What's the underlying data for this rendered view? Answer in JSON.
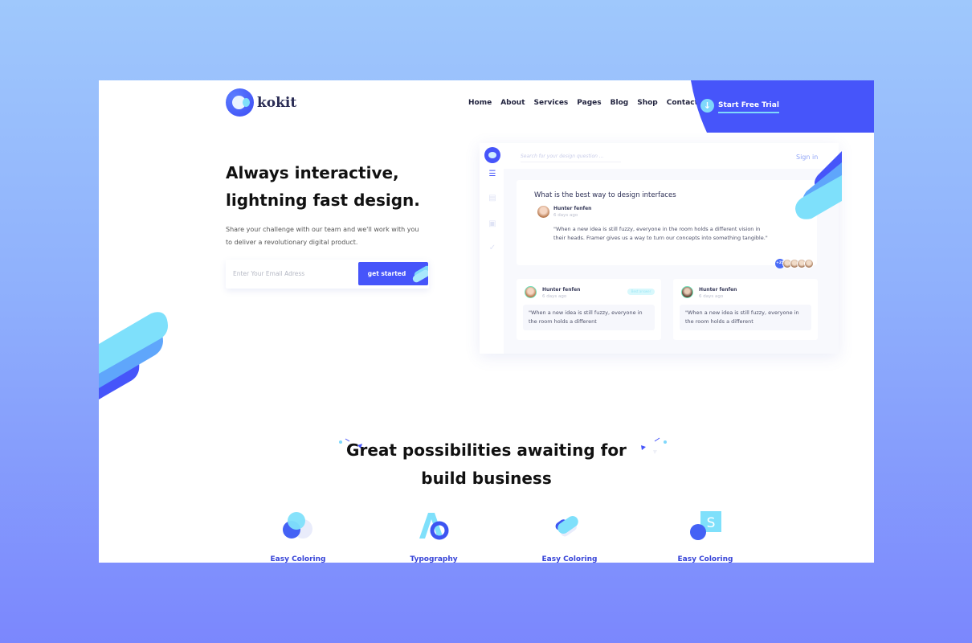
{
  "brand": {
    "name": "kokit",
    "icon": "logo-circle-icon"
  },
  "nav": {
    "items": [
      "Home",
      "About",
      "Services",
      "Pages",
      "Blog",
      "Shop",
      "Contact"
    ],
    "cta": {
      "label": "Start Free Trial",
      "icon": "download-arrow-icon"
    }
  },
  "hero": {
    "title_line1": "Always interactive,",
    "title_line2": "lightning fast design.",
    "subtitle": "Share your challenge with our team and we'll work with you to deliver a revolutionary digital product.",
    "email_placeholder": "Enter Your Email Adress",
    "button_label": "get started"
  },
  "mockup": {
    "search_placeholder": "Search for your design question ...",
    "sign_in": "Sign in",
    "sidebar_icons": [
      "logo-icon",
      "sliders-icon",
      "document-icon",
      "contact-icon",
      "check-icon"
    ],
    "main_card": {
      "title": "What is the best way to design interfaces",
      "author": "Hunter fenfen",
      "time": "6 days ago",
      "quote": "\"When a new idea is still fuzzy, everyone in the room holds a different  vision in their heads. Framer gives us a way to turn our concepts into something tangible.\"",
      "participants_extra": "+25"
    },
    "small_cards": [
      {
        "author": "Hunter fenfen",
        "time": "6 days ago",
        "badge": "Best answer",
        "quote": "\"When a new idea is still fuzzy, everyone in the room holds a different"
      },
      {
        "author": "Hunter fenfen",
        "time": "6 days ago",
        "quote": "\"When a new idea is still fuzzy, everyone in the room holds a different"
      }
    ]
  },
  "features": {
    "title_line1": "Great possibilities awaiting for",
    "title_line2": "build business",
    "items": [
      {
        "label": "Easy Coloring",
        "icon": "color-circles-icon"
      },
      {
        "label": "Typography",
        "icon": "typography-icon"
      },
      {
        "label": "Easy Coloring",
        "icon": "pill-shapes-icon"
      },
      {
        "label": "Easy Coloring",
        "icon": "s-square-icon"
      }
    ]
  },
  "colors": {
    "primary": "#4655fa",
    "accent": "#7fd8fb",
    "heading": "#111111",
    "feature_label": "#3845d8"
  }
}
